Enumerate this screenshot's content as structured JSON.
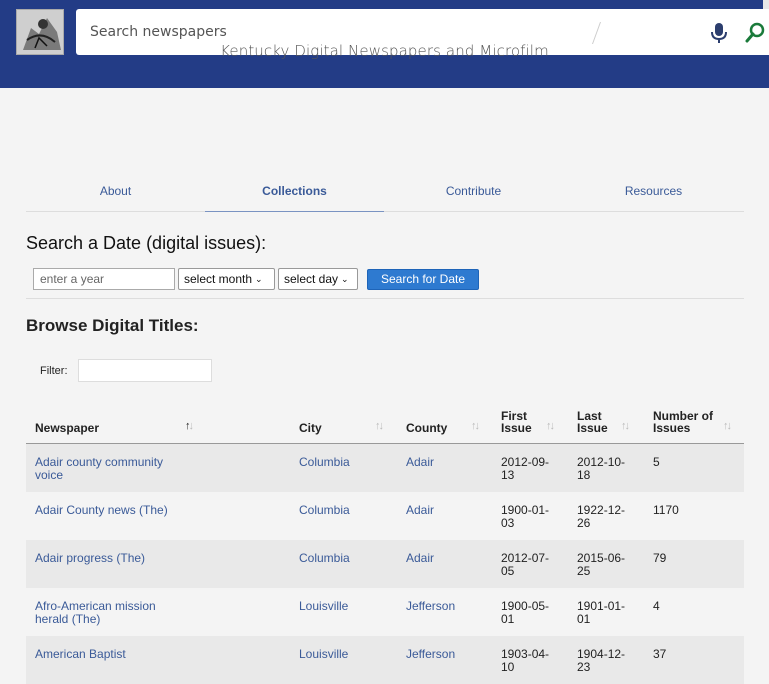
{
  "header": {
    "search_placeholder": "Search newspapers",
    "icons": [
      "mic-icon",
      "search-icon"
    ]
  },
  "site_title": "Kentucky Digital Newspapers and Microfilm",
  "tabs": [
    {
      "label": "About",
      "active": false
    },
    {
      "label": "Collections",
      "active": true
    },
    {
      "label": "Contribute",
      "active": false
    },
    {
      "label": "Resources",
      "active": false
    }
  ],
  "date_search": {
    "heading": "Search a Date (digital issues):",
    "year_placeholder": "enter a year",
    "month_label": "select month",
    "day_label": "select day",
    "button_label": "Search for Date"
  },
  "browse": {
    "heading": "Browse Digital Titles:",
    "filter_label": "Filter:"
  },
  "table": {
    "columns": {
      "newspaper": "Newspaper",
      "city": "City",
      "county": "County",
      "first_1": "First",
      "first_2": "Issue",
      "last_1": "Last",
      "last_2": "Issue",
      "num_1": "Number of",
      "num_2": "Issues"
    },
    "rows": [
      {
        "newspaper_1": "Adair county community",
        "newspaper_2": "voice",
        "city": "Columbia",
        "county": "Adair",
        "first_1": "2012-09-",
        "first_2": "13",
        "last_1": "2012-10-",
        "last_2": "18",
        "issues": "5"
      },
      {
        "newspaper_1": "Adair County news (The)",
        "newspaper_2": "",
        "city": "Columbia",
        "county": "Adair",
        "first_1": "1900-01-",
        "first_2": "03",
        "last_1": "1922-12-",
        "last_2": "26",
        "issues": "1170"
      },
      {
        "newspaper_1": "Adair progress (The)",
        "newspaper_2": "",
        "city": "Columbia",
        "county": "Adair",
        "first_1": "2012-07-",
        "first_2": "05",
        "last_1": "2015-06-",
        "last_2": "25",
        "issues": "79"
      },
      {
        "newspaper_1": "Afro-American mission",
        "newspaper_2": "herald (The)",
        "city": "Louisville",
        "county": "Jefferson",
        "first_1": "1900-05-",
        "first_2": "01",
        "last_1": "1901-01-",
        "last_2": "01",
        "issues": "4"
      },
      {
        "newspaper_1": "American Baptist",
        "newspaper_2": "",
        "city": "Louisville",
        "county": "Jefferson",
        "first_1": "1903-04-",
        "first_2": "10",
        "last_1": "1904-12-",
        "last_2": "23",
        "issues": "37"
      }
    ]
  },
  "colors": {
    "header_bg": "#233c86",
    "link": "#3a5a98",
    "button": "#2e7ad0",
    "page_bg": "#f4f4f4"
  }
}
